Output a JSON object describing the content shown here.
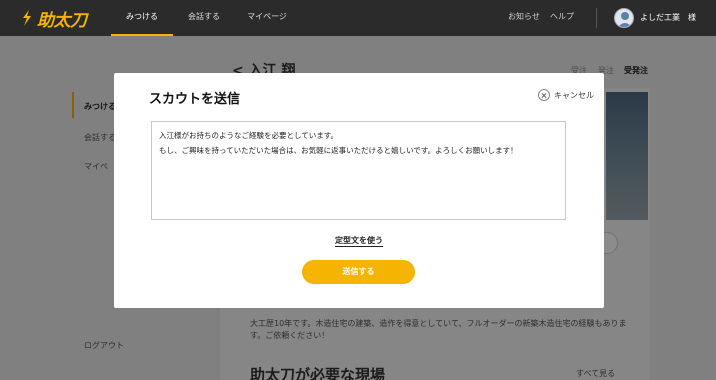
{
  "header": {
    "logo_text": "助太刀",
    "nav": [
      "みつける",
      "会話する",
      "マイページ"
    ],
    "notifications": "お知らせ",
    "help": "ヘルプ",
    "user_name": "よしだ工業　様"
  },
  "background": {
    "sidebar": [
      "みつける",
      "会話する",
      "マイペ",
      "ログアウト"
    ],
    "person_name": "< 入江 翔",
    "tabs": [
      "受注",
      "発注",
      "受発注"
    ],
    "profile_desc": "大工歴10年です。木造住宅の建築、造作を得意としていて、フルオーダーの新築木造住宅の経験もあります。ご依頼ください！",
    "section_title": "助太刀が必要な現場",
    "see_all": "すべて見る"
  },
  "modal": {
    "title": "スカウトを送信",
    "cancel": "キャンセル",
    "message_line1": "入江様がお持ちのようなご経験を必要としています。",
    "message_line2": "もし、ご興味を持っていただいた場合は、お気軽に返事いただけると嬉しいです。よろしくお願いします！",
    "template_link": "定型文を使う",
    "send_button": "送信する"
  },
  "colors": {
    "accent": "#f5b400",
    "topbar": "#2b2b2b"
  }
}
